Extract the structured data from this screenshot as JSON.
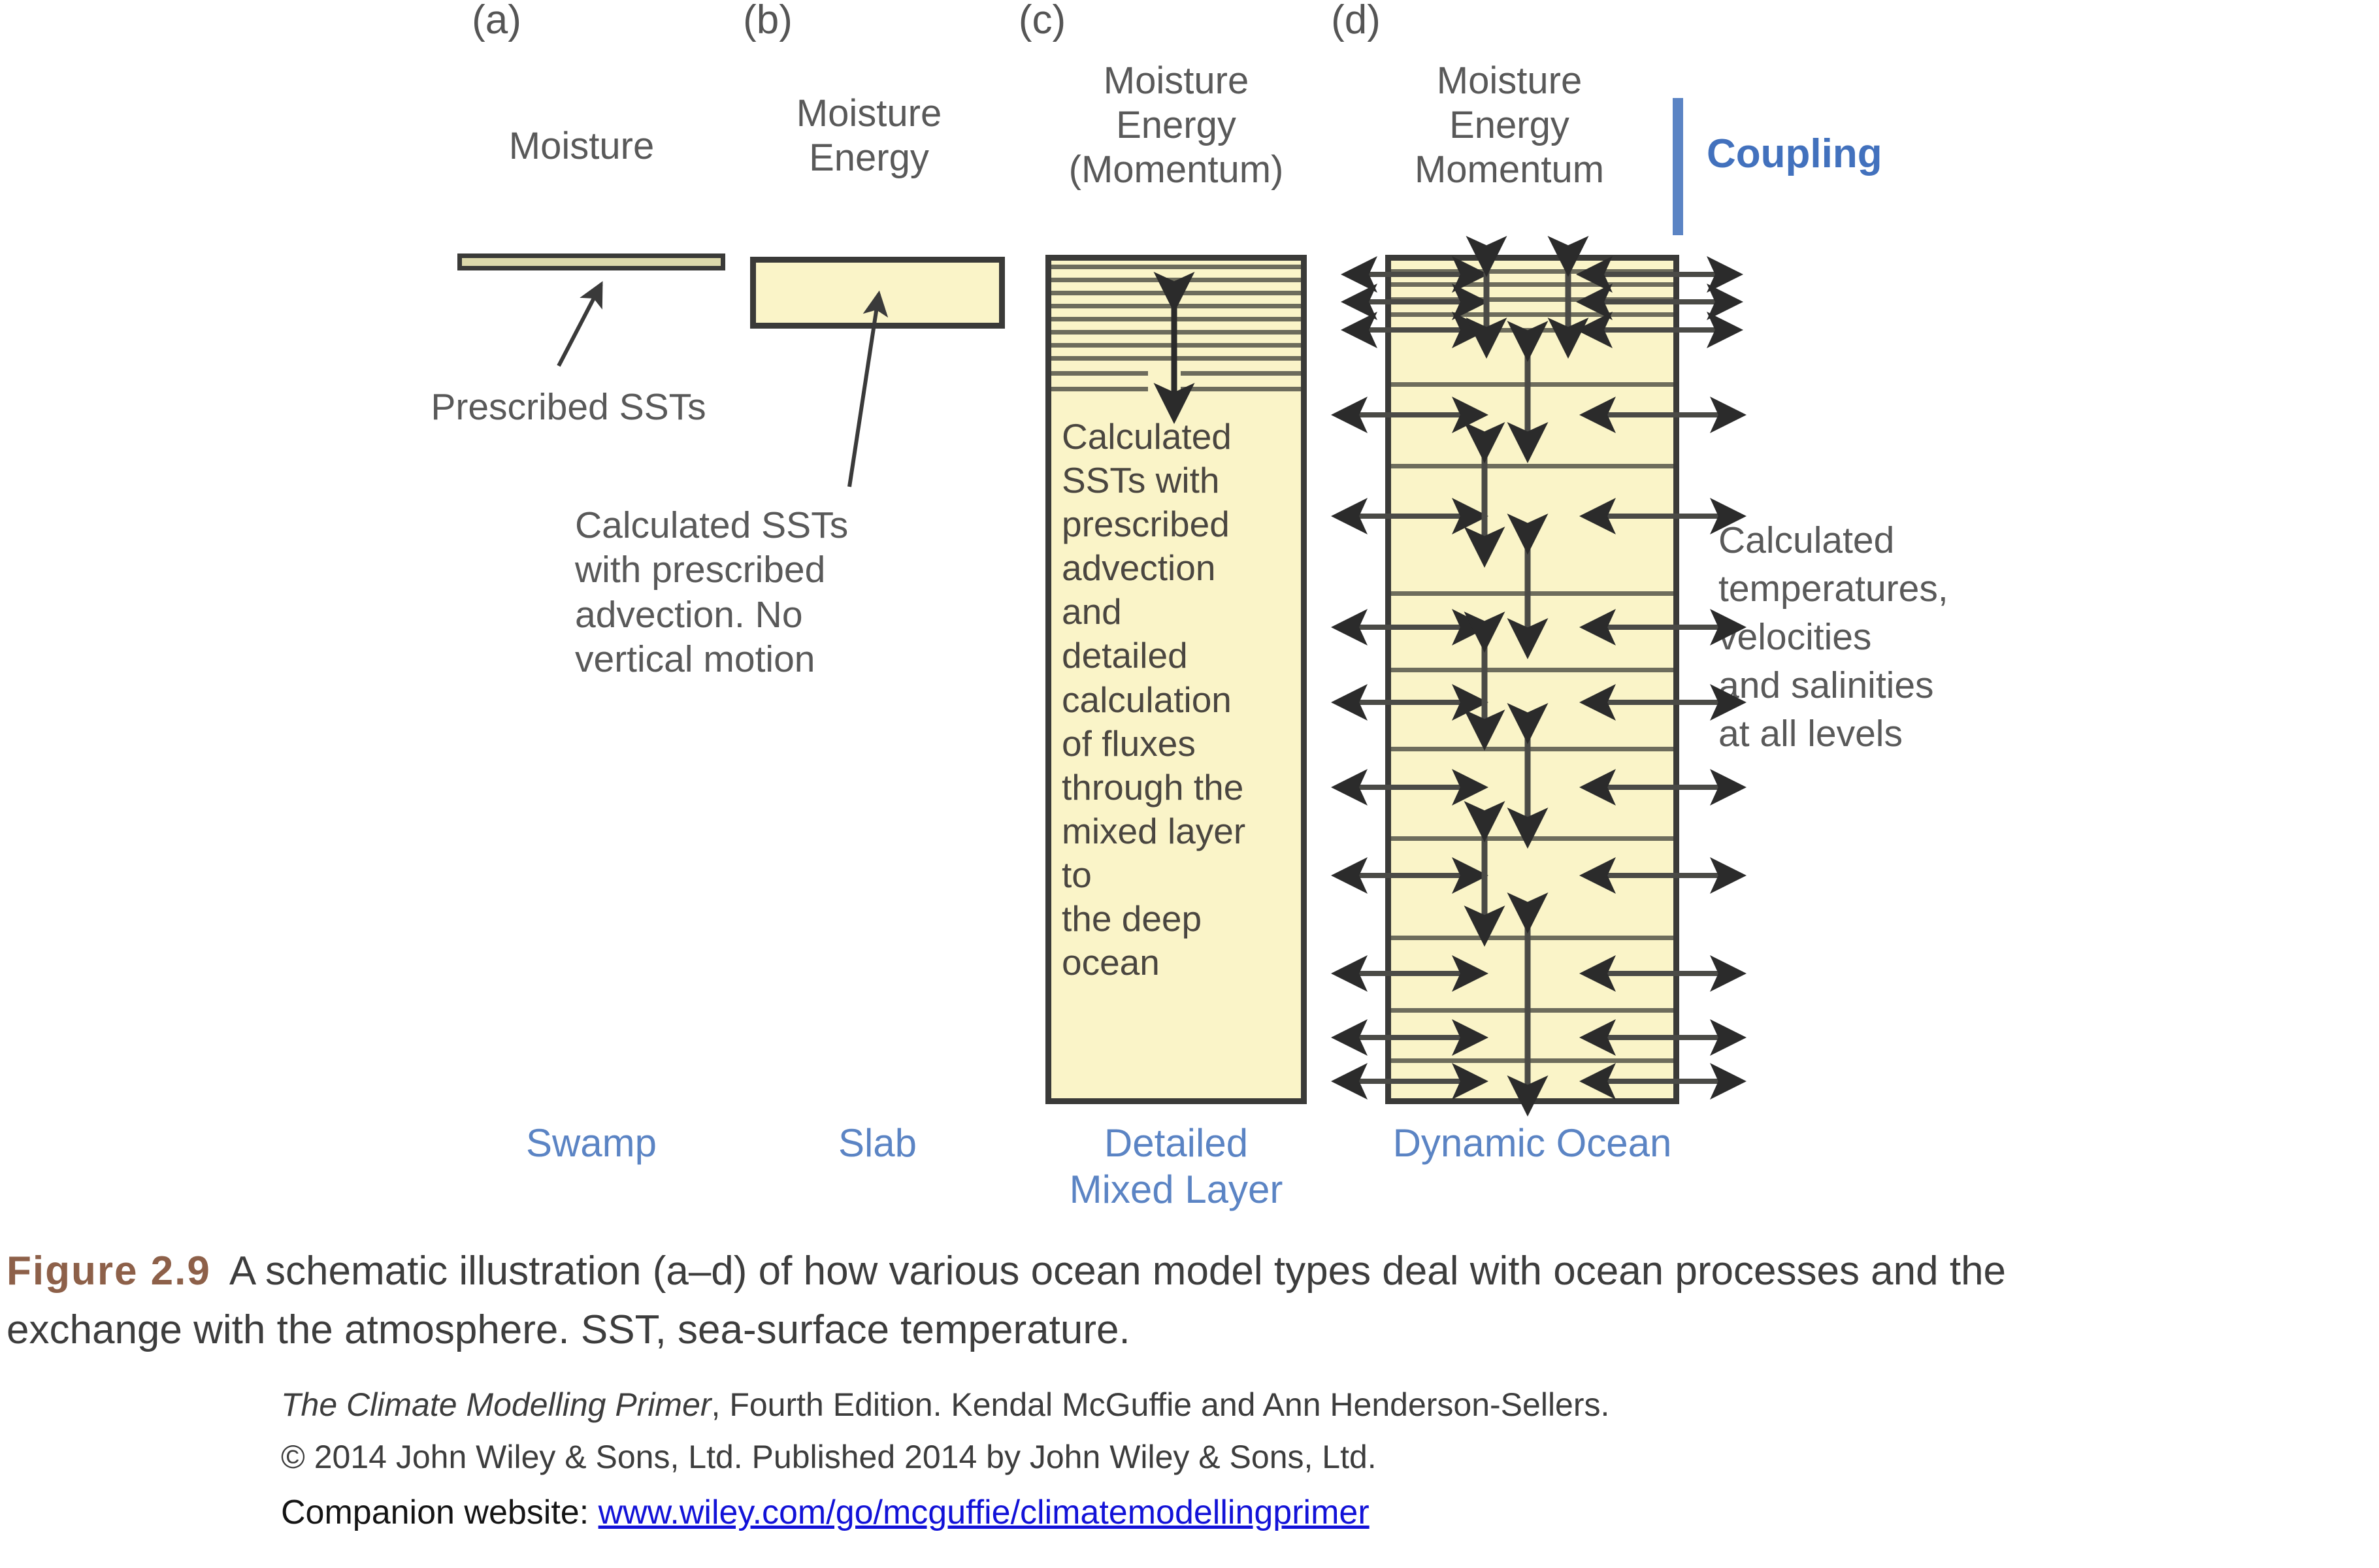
{
  "panels": [
    {
      "letter": "(a)",
      "header": "Moisture",
      "model_name": "Swamp",
      "annotation": "Prescribed SSTs"
    },
    {
      "letter": "(b)",
      "header": "Moisture\nEnergy",
      "model_name": "Slab",
      "annotation": "Calculated SSTs\nwith prescribed\nadvection. No\nvertical motion"
    },
    {
      "letter": "(c)",
      "header": "Moisture\nEnergy\n(Momentum)",
      "model_name": "Detailed\nMixed Layer",
      "annotation": "Calculated\nSSTs with\nprescribed\nadvection\nand\ndetailed\ncalculation\nof fluxes\nthrough the\nmixed layer\nto\nthe deep\nocean"
    },
    {
      "letter": "(d)",
      "header": "Moisture\nEnergy\nMomentum",
      "model_name": "Dynamic Ocean",
      "annotation": "Calculated\ntemperatures,\nvelocities\nand salinities\nat all levels"
    }
  ],
  "coupling": {
    "label": "Coupling"
  },
  "caption": {
    "figure_number": "Figure 2.9",
    "line1": "A schematic illustration (a–d) of how various ocean model types deal with ocean processes and the",
    "line2": "exchange with the atmosphere. SST, sea-surface temperature."
  },
  "credit": {
    "line1_italic": "The Climate Modelling Primer",
    "line1_rest": ", Fourth Edition. Kendal McGuffie and Ann Henderson-Sellers.",
    "line2": "© 2014 John Wiley & Sons, Ltd. Published 2014 by John Wiley & Sons, Ltd.",
    "companion_prefix": "Companion website: ",
    "companion_url": "www.wiley.com/go/mcguffie/climatemodellingprimer"
  },
  "colors": {
    "ocean_fill": "#faf4c8",
    "ocean_stroke": "#3a3a38",
    "accent_blue": "#5b84c4",
    "figure_brown": "#8d6049",
    "link_blue": "#1212d8",
    "text_gray": "#595959"
  },
  "diagram": {
    "type": "schematic",
    "panel_c_full_lines": 9,
    "panel_c_split_lines": 2,
    "panel_d_grid_rows": 12,
    "panel_d_side_arrow_rows": 11
  }
}
